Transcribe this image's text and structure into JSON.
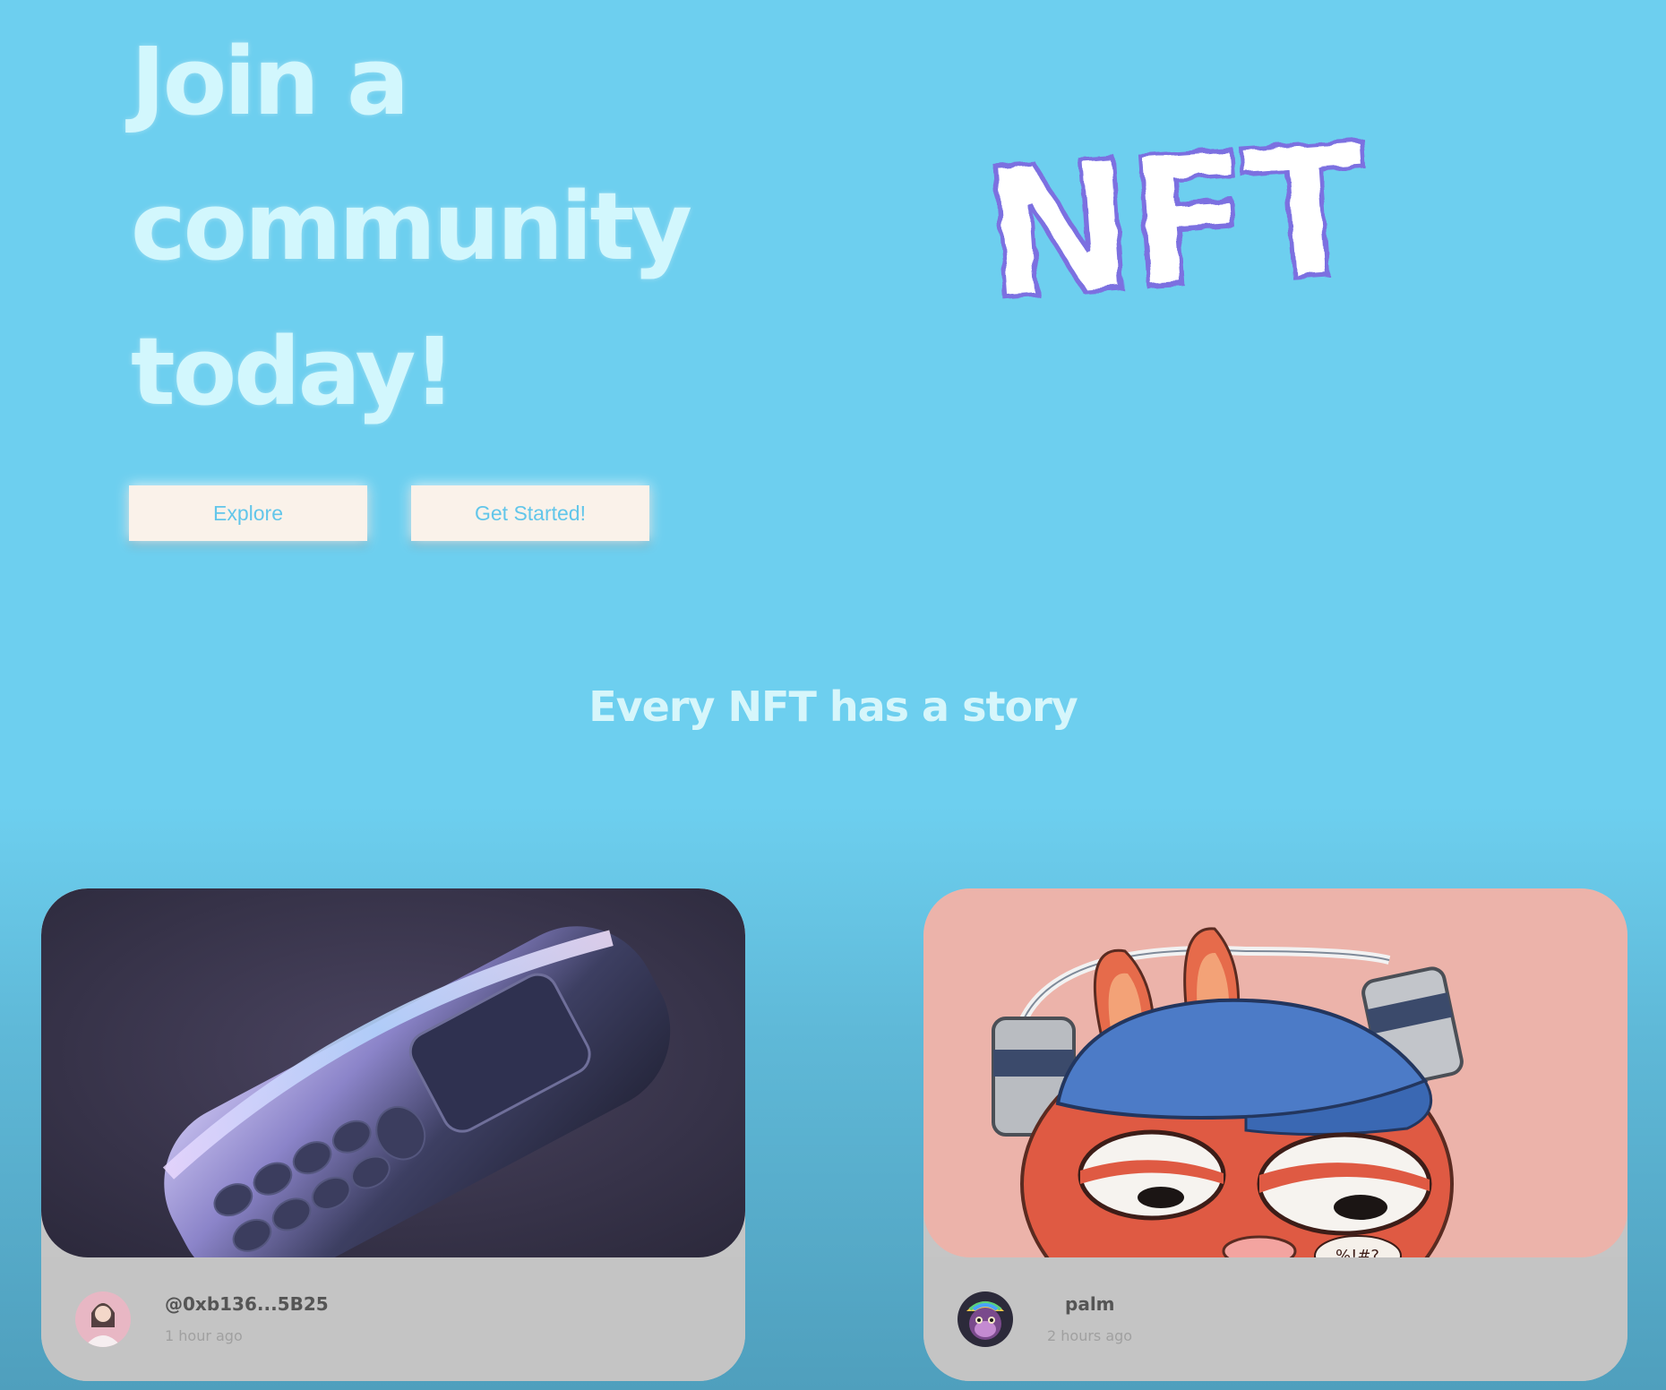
{
  "hero": {
    "title_lines": [
      "Join a",
      "community",
      "today!"
    ],
    "buttons": {
      "explore": "Explore",
      "get_started": "Get Started!"
    }
  },
  "logo": {
    "text": "NFT",
    "icon": "nft-graffiti-logo"
  },
  "section": {
    "title": "Every NFT has a story"
  },
  "cards": [
    {
      "image": "retro-phone-artwork",
      "avatar": "woman-portrait-avatar",
      "owner": "@0xb136...5B25",
      "time": "1 hour ago"
    },
    {
      "image": "bunny-beer-hat-artwork",
      "avatar": "rainbow-ape-avatar",
      "owner": "palm",
      "time": "2 hours ago",
      "art_caption": "%!#?"
    }
  ],
  "colors": {
    "background": "#6dcfef",
    "title": "#d2f7fd",
    "button_bg": "#faf2ea",
    "button_text": "#62c6ea",
    "card_footer": "#c4c4c4"
  }
}
